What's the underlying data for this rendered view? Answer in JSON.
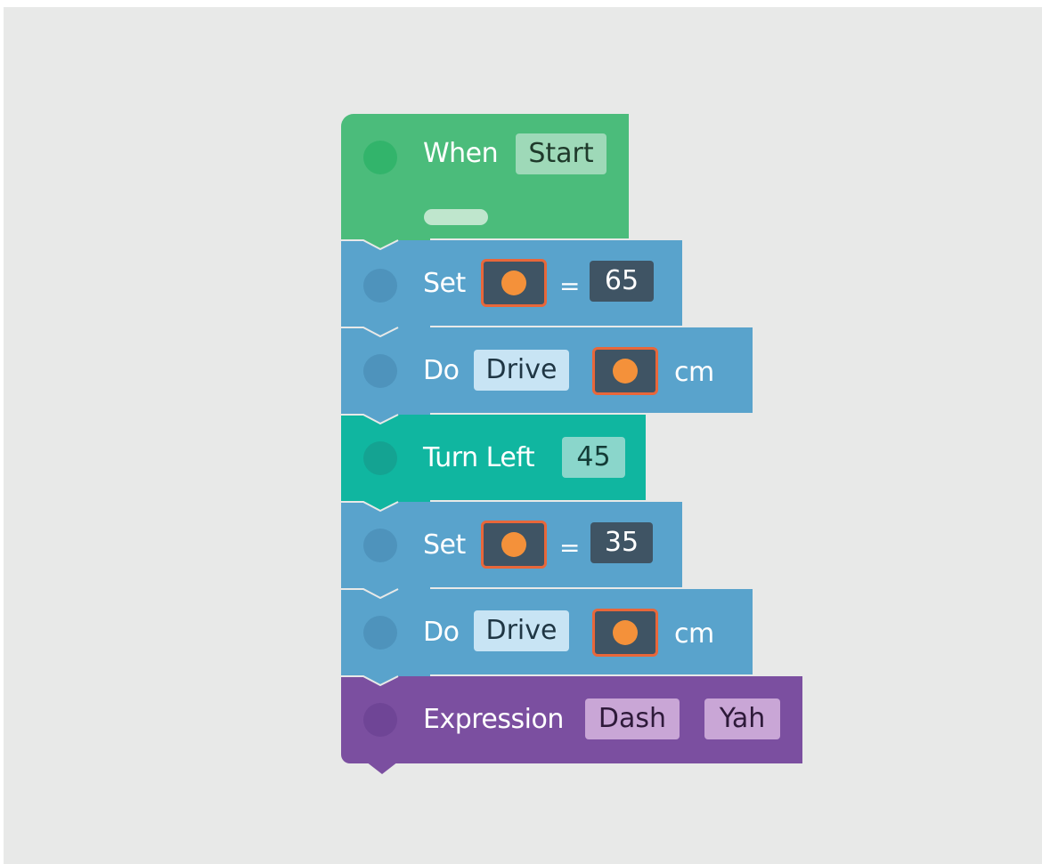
{
  "colors": {
    "background": "#e8e9e8",
    "event_block": "#4bbc7b",
    "blue_block": "#59a3cc",
    "turn_block": "#10b6a0",
    "expression_block": "#7b4fa0",
    "variable_border": "#e8673a",
    "variable_dot": "#f4913a",
    "number_chip": "#3f5464"
  },
  "program": {
    "event": {
      "keyword": "When",
      "trigger": "Start"
    },
    "set_1": {
      "keyword": "Set",
      "variable_icon": "orange-dot-icon",
      "equals": "=",
      "value": "65"
    },
    "drive_1": {
      "keyword": "Do",
      "action": "Drive",
      "variable_icon": "orange-dot-icon",
      "unit": "cm"
    },
    "turn": {
      "keyword": "Turn Left",
      "value": "45"
    },
    "set_2": {
      "keyword": "Set",
      "variable_icon": "orange-dot-icon",
      "equals": "=",
      "value": "35"
    },
    "drive_2": {
      "keyword": "Do",
      "action": "Drive",
      "variable_icon": "orange-dot-icon",
      "unit": "cm"
    },
    "expression": {
      "keyword": "Expression",
      "mood": "Dash",
      "sound": "Yah"
    }
  }
}
